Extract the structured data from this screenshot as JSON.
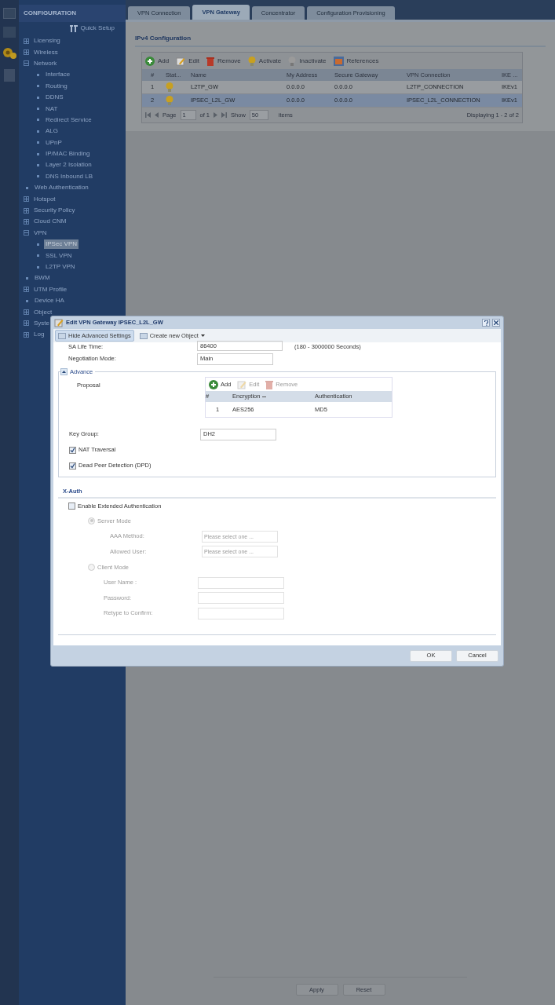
{
  "sidebar": {
    "title": "CONFIGURATION",
    "quick_setup": "Quick Setup",
    "items": [
      {
        "label": "Licensing",
        "kind": "folder",
        "expanded": false,
        "selected": false
      },
      {
        "label": "Wireless",
        "kind": "folder",
        "expanded": false,
        "selected": false
      },
      {
        "label": "Network",
        "kind": "folder",
        "expanded": true,
        "selected": false,
        "children": [
          {
            "label": "Interface",
            "kind": "leaf",
            "selected": false
          },
          {
            "label": "Routing",
            "kind": "leaf",
            "selected": false
          },
          {
            "label": "DDNS",
            "kind": "leaf",
            "selected": false
          },
          {
            "label": "NAT",
            "kind": "leaf",
            "selected": false
          },
          {
            "label": "Redirect Service",
            "kind": "leaf",
            "selected": false
          },
          {
            "label": "ALG",
            "kind": "leaf",
            "selected": false
          },
          {
            "label": "UPnP",
            "kind": "leaf",
            "selected": false
          },
          {
            "label": "IP/MAC Binding",
            "kind": "leaf",
            "selected": false
          },
          {
            "label": "Layer 2 Isolation",
            "kind": "leaf",
            "selected": false
          },
          {
            "label": "DNS Inbound LB",
            "kind": "leaf",
            "selected": false
          }
        ]
      },
      {
        "label": "Web Authentication",
        "kind": "leaf",
        "selected": false
      },
      {
        "label": "Hotspot",
        "kind": "folder",
        "expanded": false,
        "selected": false
      },
      {
        "label": "Security Policy",
        "kind": "folder",
        "expanded": false,
        "selected": false
      },
      {
        "label": "Cloud CNM",
        "kind": "folder",
        "expanded": false,
        "selected": false
      },
      {
        "label": "VPN",
        "kind": "folder",
        "expanded": true,
        "selected": false,
        "children": [
          {
            "label": "IPSec VPN",
            "kind": "leaf",
            "selected": true
          },
          {
            "label": "SSL VPN",
            "kind": "leaf",
            "selected": false
          },
          {
            "label": "L2TP VPN",
            "kind": "leaf",
            "selected": false
          }
        ]
      },
      {
        "label": "BWM",
        "kind": "leaf",
        "selected": false
      },
      {
        "label": "UTM Profile",
        "kind": "folder",
        "expanded": false,
        "selected": false
      },
      {
        "label": "Device HA",
        "kind": "leaf",
        "selected": false
      },
      {
        "label": "Object",
        "kind": "folder",
        "expanded": false,
        "selected": false
      },
      {
        "label": "Syste",
        "kind": "folder",
        "expanded": false,
        "selected": false
      },
      {
        "label": "Log",
        "kind": "folder",
        "expanded": false,
        "selected": false
      }
    ]
  },
  "tabs": [
    {
      "label": "VPN Connection",
      "selected": false
    },
    {
      "label": "VPN Gateway",
      "selected": true
    },
    {
      "label": "Concentrator",
      "selected": false
    },
    {
      "label": "Configuration Provisioning",
      "selected": false
    }
  ],
  "section_title": "IPv4 Configuration",
  "toolbar": [
    {
      "label": "Add",
      "kind": "add"
    },
    {
      "label": "Edit",
      "kind": "edit"
    },
    {
      "label": "Remove",
      "kind": "remove"
    },
    {
      "label": "Activate",
      "kind": "activate"
    },
    {
      "label": "Inactivate",
      "kind": "inactivate"
    },
    {
      "label": "References",
      "kind": "references"
    }
  ],
  "table": {
    "columns": [
      "#",
      "Stat...",
      "Name",
      "My Address",
      "Secure Gateway",
      "VPN Connection",
      "IKE ..."
    ],
    "rows": [
      {
        "cells": [
          "1",
          "",
          "L2TP_GW",
          "0.0.0.0",
          "0.0.0.0",
          "L2TP_CONNECTION",
          "IKEv1"
        ],
        "active": true,
        "selected": false
      },
      {
        "cells": [
          "2",
          "",
          "IPSEC_L2L_GW",
          "0.0.0.0",
          "0.0.0.0",
          "IPSEC_L2L_CONNECTION",
          "IKEv1"
        ],
        "active": true,
        "selected": true
      }
    ]
  },
  "pager": {
    "page_label": "Page",
    "page": "1",
    "of": "of 1",
    "show_label": "Show",
    "show": "50",
    "items_label": "items",
    "display": "Displaying 1 - 2 of 2"
  },
  "footer_buttons": [
    "Apply",
    "Reset"
  ],
  "dialog": {
    "title": "Edit VPN Gateway IPSEC_L2L_GW",
    "toolbar": [
      {
        "label": "Hide Advanced Settings",
        "selected": true
      },
      {
        "label": "Create new Object",
        "selected": false
      }
    ],
    "sa_life_time": {
      "label": "SA Life Time:",
      "value": "86400",
      "hint": "(180 - 3000000 Seconds)"
    },
    "negotiation_mode": {
      "label": "Negotiation Mode:",
      "value": "Main"
    },
    "advance": {
      "label": "Advance",
      "expanded": true,
      "proposal_label": "Proposal",
      "proposal_toolbar": [
        {
          "label": "Add",
          "kind": "add",
          "disabled": false
        },
        {
          "label": "Edit",
          "kind": "edit",
          "disabled": true
        },
        {
          "label": "Remove",
          "kind": "remove",
          "disabled": true
        }
      ],
      "proposal_columns": [
        "#",
        "Encryption",
        "Authentication"
      ],
      "proposal_rows": [
        [
          "1",
          "AES256",
          "MD5"
        ]
      ],
      "key_group": {
        "label": "Key Group:",
        "value": "DH2"
      },
      "checks": [
        {
          "label": "NAT Traversal",
          "checked": true
        },
        {
          "label": "Dead Peer Detection (DPD)",
          "checked": true
        }
      ]
    },
    "xauth": {
      "title": "X-Auth",
      "enable": {
        "label": "Enable Extended Authentication",
        "checked": false
      },
      "server_mode": {
        "label": "Server Mode",
        "selected": true,
        "disabled": true,
        "fields": [
          {
            "label": "AAA Method:",
            "placeholder": "Please select one ..."
          },
          {
            "label": "Allowed User:",
            "placeholder": "Please select one ..."
          }
        ]
      },
      "client_mode": {
        "label": "Client Mode",
        "selected": false,
        "disabled": true,
        "fields": [
          {
            "label": "User Name :"
          },
          {
            "label": "Password:"
          },
          {
            "label": "Retype to Confirm:"
          }
        ]
      }
    },
    "buttons": [
      "OK",
      "Cancel"
    ]
  }
}
